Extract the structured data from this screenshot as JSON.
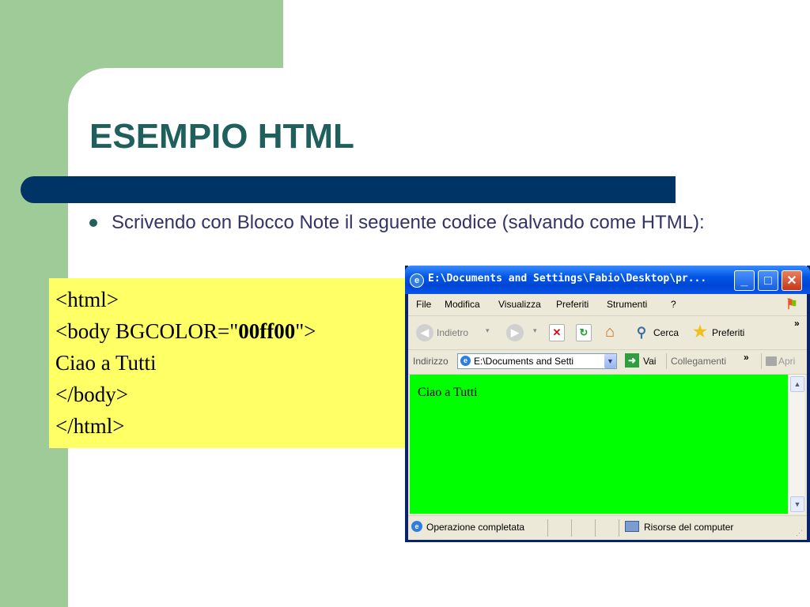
{
  "slide": {
    "title": "ESEMPIO HTML",
    "bullet": "Scrivendo con Blocco Note il seguente codice (salvando come HTML):"
  },
  "code": {
    "line1": "<html>",
    "line2_prefix": "<body BGCOLOR=\"",
    "line2_value": "00ff00",
    "line2_suffix": "\">",
    "line3": "Ciao a Tutti",
    "line4": "</body>",
    "line5": "</html>"
  },
  "browser": {
    "window_title": "E:\\Documents and Settings\\Fabio\\Desktop\\pr...",
    "menu": [
      "File",
      "Modifica",
      "Visualizza",
      "Preferiti",
      "Strumenti",
      "?"
    ],
    "toolbar": {
      "back_label": "Indietro",
      "search_label": "Cerca",
      "favorites_label": "Preferiti",
      "more": "»"
    },
    "address": {
      "label": "Indirizzo",
      "value": "E:\\Documents and Setti",
      "go_label": "Vai",
      "links_label": "Collegamenti",
      "links_more": "»",
      "open_label": "Apri"
    },
    "page_content": "Ciao a Tutti",
    "page_bgcolor": "#00ff00",
    "status": {
      "left": "Operazione completata",
      "right": "Risorse del computer"
    }
  },
  "colors": {
    "slide_green": "#9fcb99",
    "title_bar": "#003366",
    "title_text": "#1f5f5c",
    "code_box": "#ffff66"
  }
}
